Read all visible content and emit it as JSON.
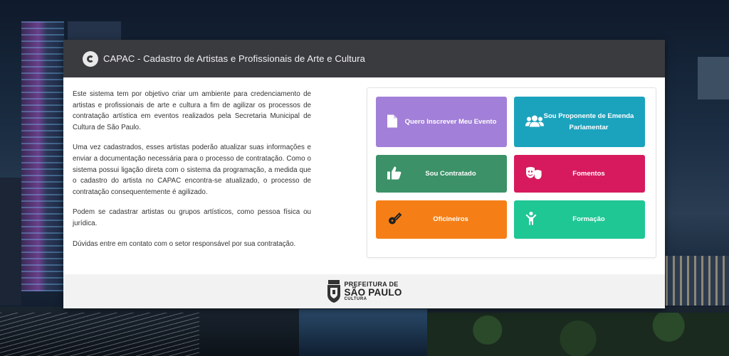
{
  "header": {
    "title": "CAPAC - Cadastro de Artistas e Profissionais de Arte e Cultura"
  },
  "intro": {
    "paragraphs": [
      "Este sistema tem por objetivo criar um ambiente para credenciamento de artistas e profissionais de arte e cultura a fim de agilizar os processos de contratação artística em eventos realizados pela Secretaria Municipal de Cultura de São Paulo.",
      "Uma vez cadastrados, esses artistas poderão atualizar suas informações e enviar a documentação necessária para o processo de contratação. Como o sistema possui ligação direta com o sistema da programação, a medida que o cadastro do artista no CAPAC encontra-se atualizado, o processo de contratação consequentemente é agilizado.",
      "Podem se cadastrar artistas ou grupos artísticos, como pessoa física ou jurídica.",
      "Dúvidas entre em contato com o setor responsável por sua contratação."
    ]
  },
  "menu": {
    "tiles": [
      {
        "label": "Quero Inscrever Meu Evento",
        "icon": "document-icon",
        "color": "#a27fd8"
      },
      {
        "label": "Sou Proponente de Emenda Parlamentar",
        "icon": "users-icon",
        "color": "#1ba3be"
      },
      {
        "label": "Sou Contratado",
        "icon": "thumbs-up-icon",
        "color": "#3c9168"
      },
      {
        "label": "Fomentos",
        "icon": "theater-masks-icon",
        "color": "#d71a5d"
      },
      {
        "label": "Oficineiros",
        "icon": "guitar-icon",
        "color": "#f57f16"
      },
      {
        "label": "Formação",
        "icon": "child-icon",
        "color": "#1fc795"
      }
    ]
  },
  "footer": {
    "logo_top": "PREFEITURA DE",
    "logo_mid": "SÃO PAULO",
    "logo_bot": "CULTURA"
  }
}
